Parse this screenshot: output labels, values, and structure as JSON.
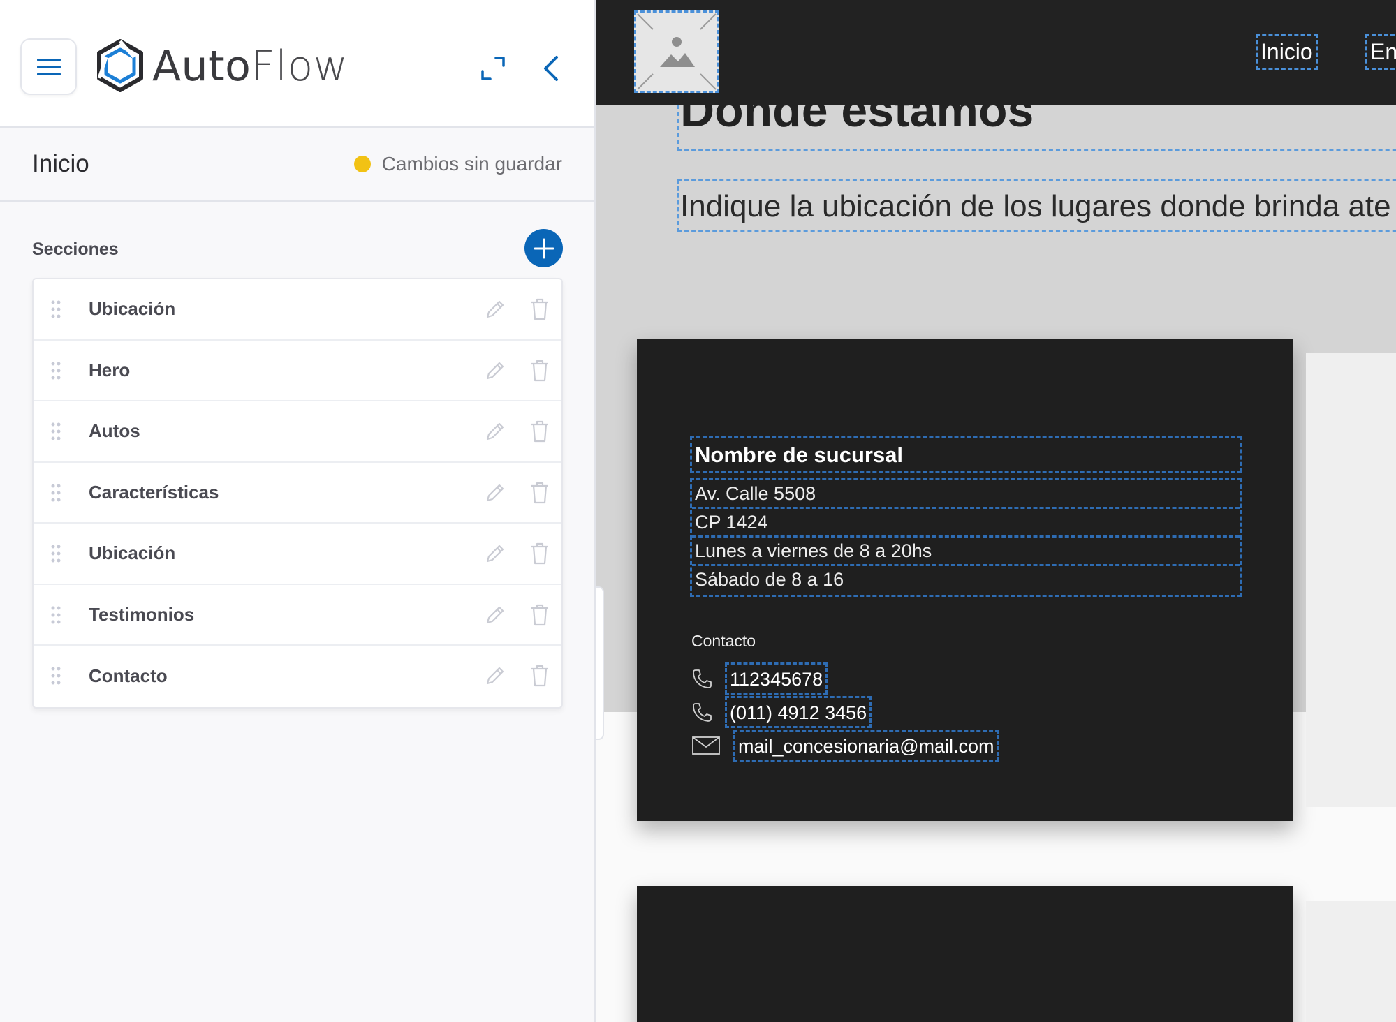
{
  "app": {
    "name_bold": "Auto",
    "name_light": "Flow"
  },
  "page": {
    "title": "Inicio",
    "status": "Cambios sin guardar",
    "status_color": "#f2c214"
  },
  "sections": {
    "heading": "Secciones",
    "items": [
      {
        "label": "Ubicación"
      },
      {
        "label": "Hero"
      },
      {
        "label": "Autos"
      },
      {
        "label": "Características"
      },
      {
        "label": "Ubicación"
      },
      {
        "label": "Testimonios"
      },
      {
        "label": "Contacto"
      }
    ]
  },
  "preview": {
    "nav": {
      "links": [
        "Inicio",
        "En"
      ]
    },
    "heading": "Donde estamos",
    "subheading": "Indique la ubicación de los lugares donde brinda ate",
    "branch": {
      "name": "Nombre de sucursal",
      "lines": [
        "Av. Calle 5508",
        "CP 1424",
        "Lunes a viernes de 8 a 20hs",
        "Sábado de 8 a 16"
      ],
      "contact_heading": "Contacto",
      "phones": [
        "112345678",
        "(011) 4912 3456"
      ],
      "email": "mail_concesionaria@mail.com"
    }
  },
  "colors": {
    "accent": "#0a66b7",
    "dark": "#1f1f1f",
    "selection": "#4a90d9"
  }
}
